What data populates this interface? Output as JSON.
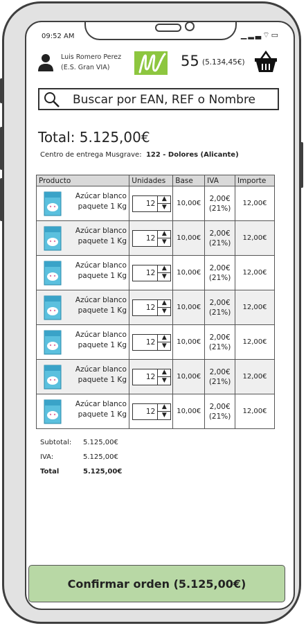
{
  "status_bar": {
    "time": "09:52 AM",
    "icons": [
      "signal-icon",
      "wifi-icon",
      "battery-icon"
    ]
  },
  "header": {
    "user_name": "Luis Romero Perez",
    "user_store": "(E.S. Gran VIA)",
    "cart_count": "55",
    "cart_amount": "(5.134,45€)",
    "logo_color": "#8dc63f"
  },
  "search": {
    "placeholder": "Buscar por EAN, REF o Nombre"
  },
  "order": {
    "total_label": "Total: 5.125,00€",
    "delivery_label": "Centro de entrega Musgrave:",
    "delivery_center": "122 - Dolores (Alicante)"
  },
  "table": {
    "headers": [
      "Producto",
      "Unidades",
      "Base",
      "IVA",
      "Importe"
    ],
    "rows": [
      {
        "name": "Azúcar blanco paquete 1 Kg",
        "units": "12",
        "base": "10,00€",
        "iva_amount": "2,00€",
        "iva_rate": "(21%)",
        "importe": "12,00€"
      },
      {
        "name": "Azúcar blanco paquete 1 Kg",
        "units": "12",
        "base": "10,00€",
        "iva_amount": "2,00€",
        "iva_rate": "(21%)",
        "importe": "12,00€"
      },
      {
        "name": "Azúcar blanco paquete 1 Kg",
        "units": "12",
        "base": "10,00€",
        "iva_amount": "2,00€",
        "iva_rate": "(21%)",
        "importe": "12,00€"
      },
      {
        "name": "Azúcar blanco paquete 1 Kg",
        "units": "12",
        "base": "10,00€",
        "iva_amount": "2,00€",
        "iva_rate": "(21%)",
        "importe": "12,00€"
      },
      {
        "name": "Azúcar blanco paquete 1 Kg",
        "units": "12",
        "base": "10,00€",
        "iva_amount": "2,00€",
        "iva_rate": "(21%)",
        "importe": "12,00€"
      },
      {
        "name": "Azúcar blanco paquete 1 Kg",
        "units": "12",
        "base": "10,00€",
        "iva_amount": "2,00€",
        "iva_rate": "(21%)",
        "importe": "12,00€"
      },
      {
        "name": "Azúcar blanco paquete 1 Kg",
        "units": "12",
        "base": "10,00€",
        "iva_amount": "2,00€",
        "iva_rate": "(21%)",
        "importe": "12,00€"
      }
    ]
  },
  "summary": {
    "subtotal_label": "Subtotal:",
    "subtotal_value": "5.125,00€",
    "iva_label": "IVA:",
    "iva_value": "5.125,00€",
    "total_label": "Total",
    "total_value": "5.125,00€"
  },
  "confirm_button": {
    "label": "Confirmar orden (5.125,00€)",
    "color": "#b8d8a5"
  }
}
